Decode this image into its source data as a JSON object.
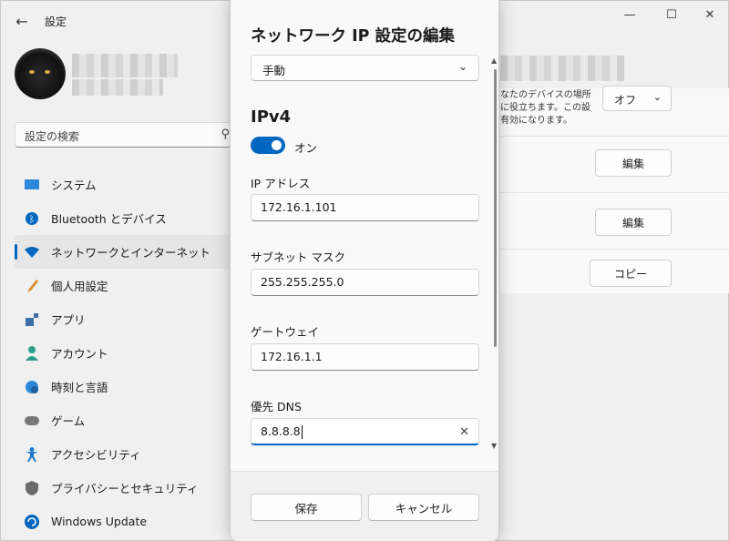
{
  "window": {
    "title": "設定",
    "back_icon": "arrow-left-icon",
    "controls": [
      "minimize-icon",
      "maximize-icon",
      "close-icon"
    ]
  },
  "search": {
    "placeholder": "設定の検索"
  },
  "sidebar": {
    "items": [
      {
        "label": "システム",
        "icon": "system-icon",
        "color": "#2b88d8"
      },
      {
        "label": "Bluetooth とデバイス",
        "icon": "bluetooth-icon",
        "color": "#0067c0"
      },
      {
        "label": "ネットワークとインターネット",
        "icon": "wifi-icon",
        "color": "#0067c0",
        "active": true
      },
      {
        "label": "個人用設定",
        "icon": "brush-icon",
        "color": "#d98b2b"
      },
      {
        "label": "アプリ",
        "icon": "apps-icon",
        "color": "#3a6ea5"
      },
      {
        "label": "アカウント",
        "icon": "person-icon",
        "color": "#2aa08c"
      },
      {
        "label": "時刻と言語",
        "icon": "globe-clock-icon",
        "color": "#2b88d8"
      },
      {
        "label": "ゲーム",
        "icon": "gamepad-icon",
        "color": "#777777"
      },
      {
        "label": "アクセシビリティ",
        "icon": "accessibility-icon",
        "color": "#1f78c8"
      },
      {
        "label": "プライバシーとセキュリティ",
        "icon": "shield-icon",
        "color": "#6b6b6b"
      },
      {
        "label": "Windows Update",
        "icon": "update-icon",
        "color": "#0067c0"
      }
    ]
  },
  "background_content": {
    "description_lines": [
      "なたのデバイスの場所",
      "に役立ちます。この設",
      "有効になります。"
    ],
    "select_value": "オフ",
    "edit_button_1": "編集",
    "edit_button_2": "編集",
    "copy_button": "コピー"
  },
  "dialog": {
    "title": "ネットワーク IP 設定の編集",
    "mode_value": "手動",
    "section": "IPv4",
    "toggle_label": "オン",
    "toggle_on": true,
    "fields": {
      "ip_label": "IP アドレス",
      "ip_value": "172.16.1.101",
      "mask_label": "サブネット マスク",
      "mask_value": "255.255.255.0",
      "gateway_label": "ゲートウェイ",
      "gateway_value": "172.16.1.1",
      "dns_label": "優先 DNS",
      "dns_value": "8.8.8.8"
    },
    "save_label": "保存",
    "cancel_label": "キャンセル"
  },
  "colors": {
    "accent": "#0067c0"
  }
}
